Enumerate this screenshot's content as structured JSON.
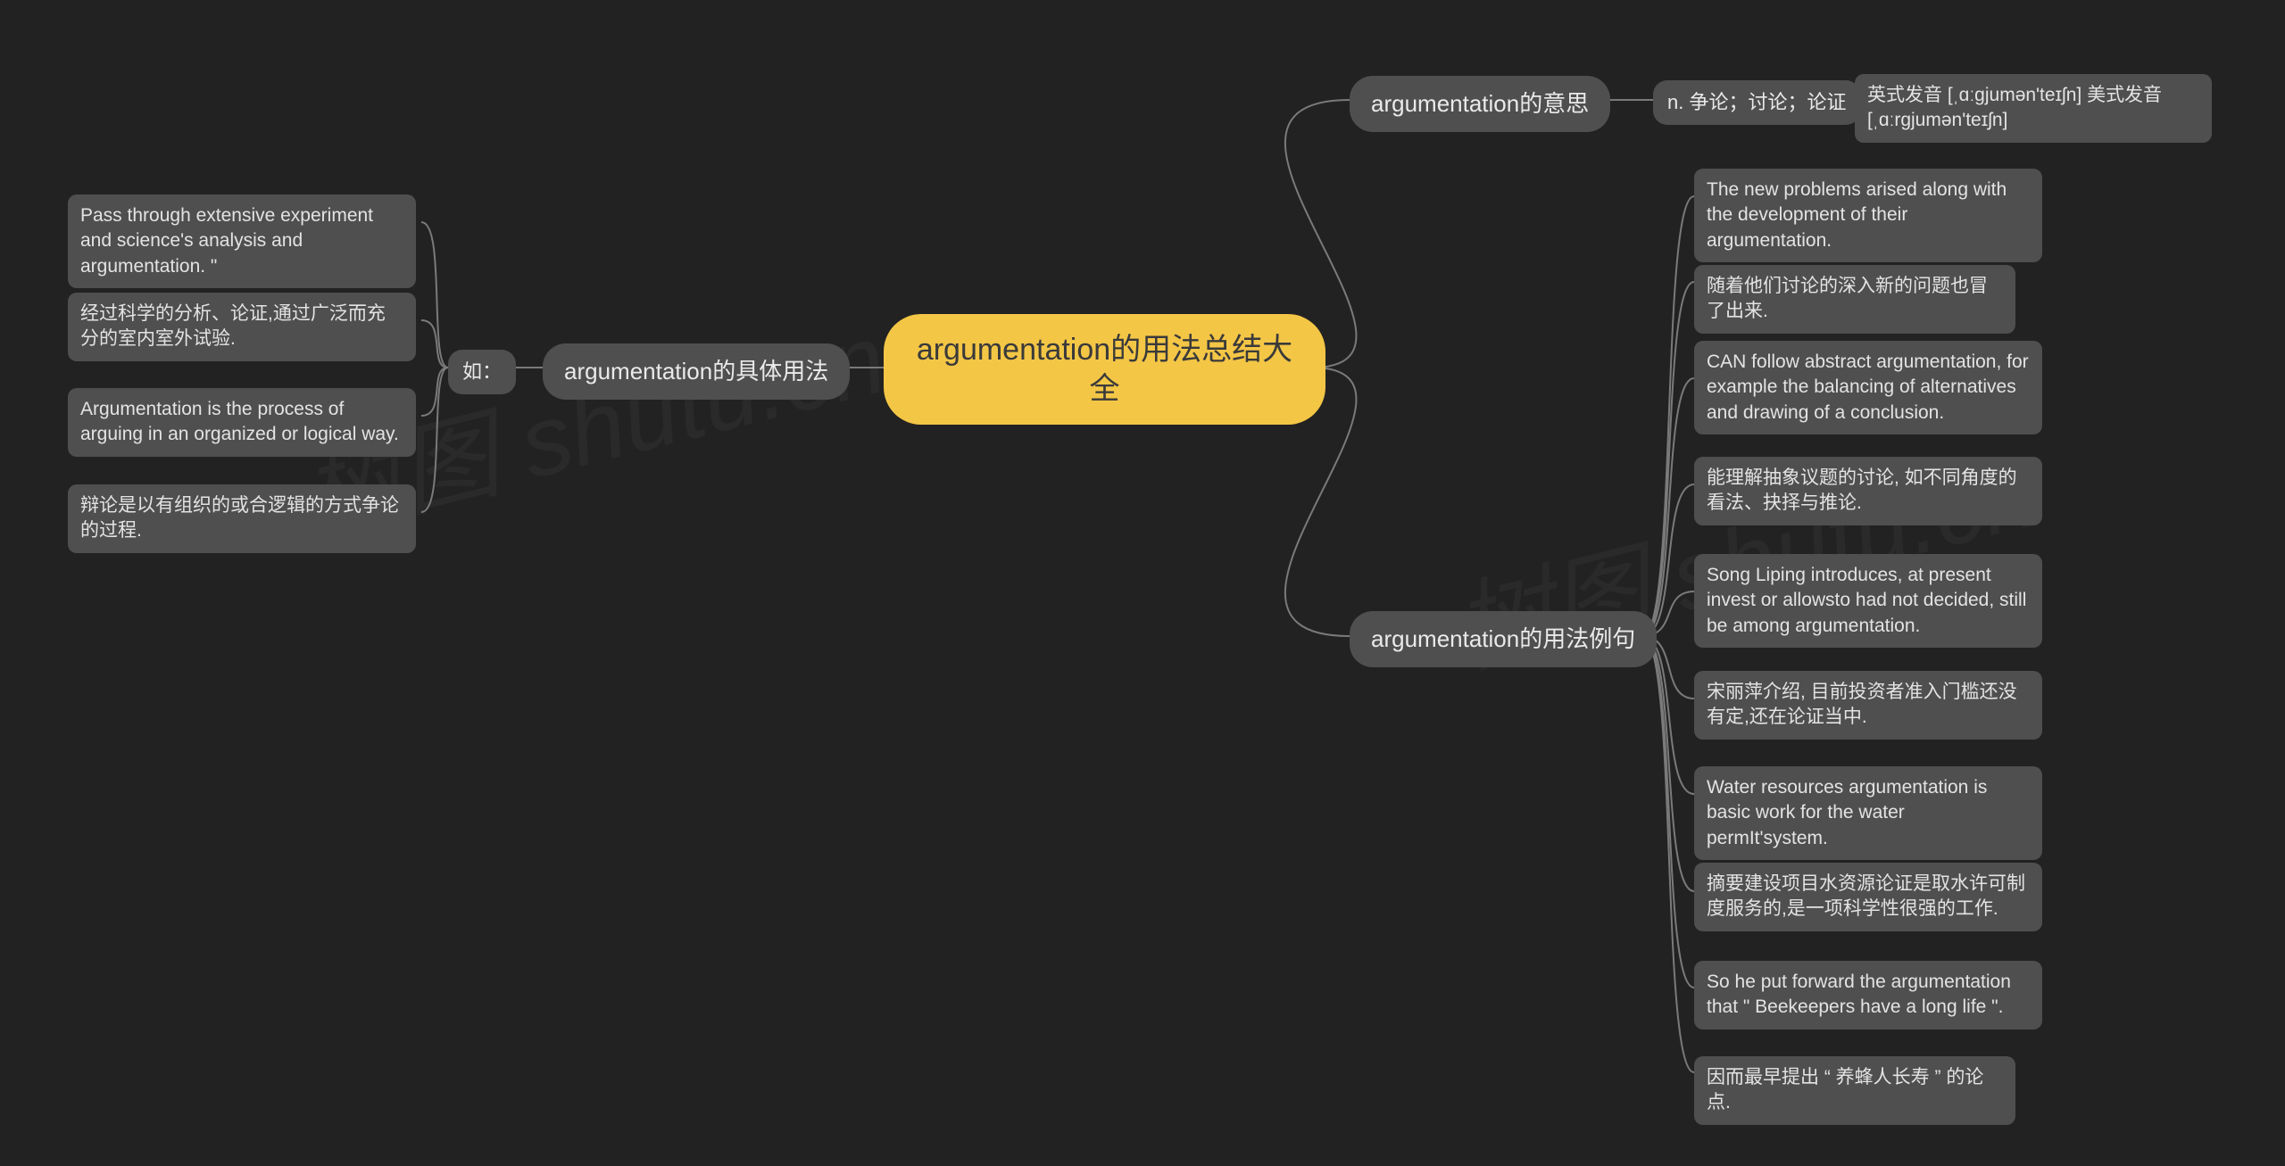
{
  "root": {
    "title": "argumentation的用法总结大全"
  },
  "branches": {
    "meaning": {
      "label": "argumentation的意思",
      "children": {
        "def": "n. 争论；讨论；论证",
        "pron": "英式发音 [ˌɑːɡjumən'teɪʃn] 美式发音 [ˌɑːrɡjumən'teɪʃn]"
      }
    },
    "examples": {
      "label": "argumentation的用法例句",
      "items": [
        "The new problems arised along with the development of their argumentation.",
        "随着他们讨论的深入新的问题也冒了出来.",
        "CAN follow abstract argumentation, for example the balancing of alternatives and drawing of a conclusion.",
        "能理解抽象议题的讨论, 如不同角度的看法、抉择与推论.",
        "Song Liping introduces, at present invest or allowsto had not decided, still be among argumentation.",
        "宋丽萍介绍, 目前投资者准入门槛还没有定,还在论证当中.",
        "Water resources argumentation is basic work for the water permIt'system.",
        "摘要建设项目水资源论证是取水许可制度服务的,是一项科学性很强的工作.",
        "So he put forward the argumentation that \" Beekeepers have a long life \".",
        "因而最早提出 “ 养蜂人长寿 ” 的论点."
      ]
    },
    "usage": {
      "label": "argumentation的具体用法",
      "sub": "如：",
      "items": [
        "Pass through extensive experiment and science's analysis and argumentation. \"",
        "经过科学的分析、论证,通过广泛而充分的室内室外试验.",
        "Argumentation is the process of arguing in an organized or logical way.",
        "辩论是以有组织的或合逻辑的方式争论的过程."
      ]
    }
  },
  "watermarks": {
    "w1": "树图 shutu.cn",
    "w2": "树图 shutu.cn"
  }
}
